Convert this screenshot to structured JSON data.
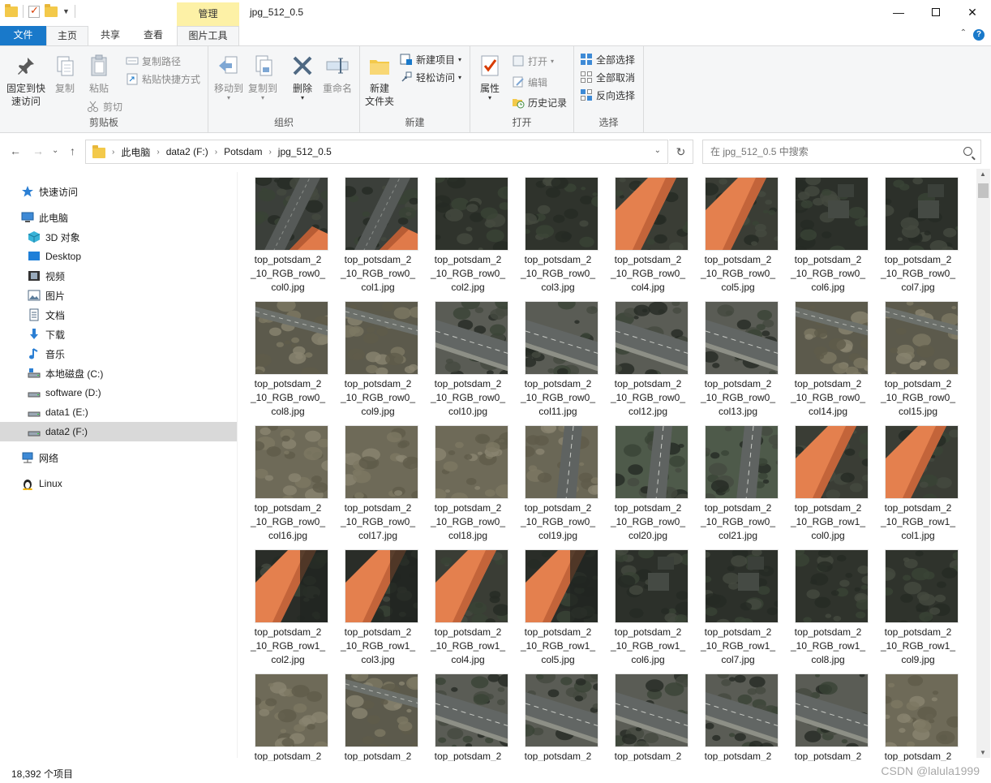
{
  "window": {
    "title": "jpg_512_0.5",
    "manage_tab": "管理"
  },
  "ribbon_tabs": [
    "文件",
    "主页",
    "共享",
    "查看",
    "图片工具"
  ],
  "ribbon": {
    "clipboard": {
      "label": "剪贴板",
      "pin": "固定到快\n速访问",
      "copy": "复制",
      "paste": "粘贴",
      "copy_path": "复制路径",
      "paste_shortcut": "粘贴快捷方式",
      "cut": "剪切"
    },
    "organize": {
      "label": "组织",
      "move_to": "移动到",
      "copy_to": "复制到",
      "delete": "删除",
      "rename": "重命名"
    },
    "new": {
      "label": "新建",
      "new_folder": "新建\n文件夹",
      "new_item": "新建项目",
      "easy_access": "轻松访问"
    },
    "open": {
      "label": "打开",
      "properties": "属性",
      "open": "打开",
      "edit": "编辑",
      "history": "历史记录"
    },
    "select": {
      "label": "选择",
      "select_all": "全部选择",
      "select_none": "全部取消",
      "invert": "反向选择"
    }
  },
  "address": {
    "crumbs": [
      "此电脑",
      "data2 (F:)",
      "Potsdam",
      "jpg_512_0.5"
    ],
    "search_placeholder": "在 jpg_512_0.5 中搜索"
  },
  "nav": {
    "items": [
      {
        "label": "快速访问",
        "icon": "star-icon"
      },
      {
        "label": "此电脑",
        "icon": "computer-icon"
      },
      {
        "label": "3D 对象",
        "icon": "cube-icon"
      },
      {
        "label": "Desktop",
        "icon": "desktop-icon"
      },
      {
        "label": "视频",
        "icon": "video-icon"
      },
      {
        "label": "图片",
        "icon": "picture-icon"
      },
      {
        "label": "文档",
        "icon": "document-icon"
      },
      {
        "label": "下载",
        "icon": "download-icon"
      },
      {
        "label": "音乐",
        "icon": "music-icon"
      },
      {
        "label": "本地磁盘 (C:)",
        "icon": "drive-c-icon"
      },
      {
        "label": "software (D:)",
        "icon": "drive-icon"
      },
      {
        "label": "data1 (E:)",
        "icon": "drive-icon"
      },
      {
        "label": "data2 (F:)",
        "icon": "drive-icon"
      },
      {
        "label": "网络",
        "icon": "network-icon"
      },
      {
        "label": "Linux",
        "icon": "linux-icon"
      }
    ]
  },
  "files": [
    {
      "line1": "top_potsdam_2",
      "line2": "_10_RGB_row0_",
      "line3": "col0.jpg",
      "scene": "road-roof"
    },
    {
      "line1": "top_potsdam_2",
      "line2": "_10_RGB_row0_",
      "line3": "col1.jpg",
      "scene": "road-roof"
    },
    {
      "line1": "top_potsdam_2",
      "line2": "_10_RGB_row0_",
      "line3": "col2.jpg",
      "scene": "shadow-trees"
    },
    {
      "line1": "top_potsdam_2",
      "line2": "_10_RGB_row0_",
      "line3": "col3.jpg",
      "scene": "shadow-trees"
    },
    {
      "line1": "top_potsdam_2",
      "line2": "_10_RGB_row0_",
      "line3": "col4.jpg",
      "scene": "roof"
    },
    {
      "line1": "top_potsdam_2",
      "line2": "_10_RGB_row0_",
      "line3": "col5.jpg",
      "scene": "roof"
    },
    {
      "line1": "top_potsdam_2",
      "line2": "_10_RGB_row0_",
      "line3": "col6.jpg",
      "scene": "dark-house"
    },
    {
      "line1": "top_potsdam_2",
      "line2": "_10_RGB_row0_",
      "line3": "col7.jpg",
      "scene": "dark-house"
    },
    {
      "line1": "top_potsdam_2",
      "line2": "_10_RGB_row0_",
      "line3": "col8.jpg",
      "scene": "field-road"
    },
    {
      "line1": "top_potsdam_2",
      "line2": "_10_RGB_row0_",
      "line3": "col9.jpg",
      "scene": "field-road"
    },
    {
      "line1": "top_potsdam_2",
      "line2": "_10_RGB_row0_",
      "line3": "col10.jpg",
      "scene": "road"
    },
    {
      "line1": "top_potsdam_2",
      "line2": "_10_RGB_row0_",
      "line3": "col11.jpg",
      "scene": "road"
    },
    {
      "line1": "top_potsdam_2",
      "line2": "_10_RGB_row0_",
      "line3": "col12.jpg",
      "scene": "road"
    },
    {
      "line1": "top_potsdam_2",
      "line2": "_10_RGB_row0_",
      "line3": "col13.jpg",
      "scene": "road"
    },
    {
      "line1": "top_potsdam_2",
      "line2": "_10_RGB_row0_",
      "line3": "col14.jpg",
      "scene": "field-road"
    },
    {
      "line1": "top_potsdam_2",
      "line2": "_10_RGB_row0_",
      "line3": "col15.jpg",
      "scene": "field-road"
    },
    {
      "line1": "top_potsdam_2",
      "line2": "_10_RGB_row0_",
      "line3": "col16.jpg",
      "scene": "field"
    },
    {
      "line1": "top_potsdam_2",
      "line2": "_10_RGB_row0_",
      "line3": "col17.jpg",
      "scene": "field"
    },
    {
      "line1": "top_potsdam_2",
      "line2": "_10_RGB_row0_",
      "line3": "col18.jpg",
      "scene": "field"
    },
    {
      "line1": "top_potsdam_2",
      "line2": "_10_RGB_row0_",
      "line3": "col19.jpg",
      "scene": "field-vroad"
    },
    {
      "line1": "top_potsdam_2",
      "line2": "_10_RGB_row0_",
      "line3": "col20.jpg",
      "scene": "vroad"
    },
    {
      "line1": "top_potsdam_2",
      "line2": "_10_RGB_row0_",
      "line3": "col21.jpg",
      "scene": "vroad"
    },
    {
      "line1": "top_potsdam_2",
      "line2": "_10_RGB_row1_",
      "line3": "col0.jpg",
      "scene": "roof"
    },
    {
      "line1": "top_potsdam_2",
      "line2": "_10_RGB_row1_",
      "line3": "col1.jpg",
      "scene": "roof"
    },
    {
      "line1": "top_potsdam_2",
      "line2": "_10_RGB_row1_",
      "line3": "col2.jpg",
      "scene": "roof-dark"
    },
    {
      "line1": "top_potsdam_2",
      "line2": "_10_RGB_row1_",
      "line3": "col3.jpg",
      "scene": "roof-dark"
    },
    {
      "line1": "top_potsdam_2",
      "line2": "_10_RGB_row1_",
      "line3": "col4.jpg",
      "scene": "roof"
    },
    {
      "line1": "top_potsdam_2",
      "line2": "_10_RGB_row1_",
      "line3": "col5.jpg",
      "scene": "roof-dark"
    },
    {
      "line1": "top_potsdam_2",
      "line2": "_10_RGB_row1_",
      "line3": "col6.jpg",
      "scene": "dark-house"
    },
    {
      "line1": "top_potsdam_2",
      "line2": "_10_RGB_row1_",
      "line3": "col7.jpg",
      "scene": "dark-house"
    },
    {
      "line1": "top_potsdam_2",
      "line2": "_10_RGB_row1_",
      "line3": "col8.jpg",
      "scene": "shadow-trees"
    },
    {
      "line1": "top_potsdam_2",
      "line2": "_10_RGB_row1_",
      "line3": "col9.jpg",
      "scene": "shadow-trees"
    },
    {
      "line1": "top_potsdam_2",
      "line2": "",
      "line3": "",
      "scene": "field"
    },
    {
      "line1": "top_potsdam_2",
      "line2": "",
      "line3": "",
      "scene": "field-road"
    },
    {
      "line1": "top_potsdam_2",
      "line2": "",
      "line3": "",
      "scene": "road"
    },
    {
      "line1": "top_potsdam_2",
      "line2": "",
      "line3": "",
      "scene": "road"
    },
    {
      "line1": "top_potsdam_2",
      "line2": "",
      "line3": "",
      "scene": "road"
    },
    {
      "line1": "top_potsdam_2",
      "line2": "",
      "line3": "",
      "scene": "road"
    },
    {
      "line1": "top_potsdam_2",
      "line2": "",
      "line3": "",
      "scene": "road"
    },
    {
      "line1": "top_potsdam_2",
      "line2": "",
      "line3": "",
      "scene": "field"
    }
  ],
  "status": {
    "item_count": "18,392 个项目",
    "watermark": "CSDN @lalula1999"
  },
  "colors": {
    "accent": "#1979ca",
    "manage_tab": "#fdf1a6",
    "selection": "#d9d9d9"
  }
}
